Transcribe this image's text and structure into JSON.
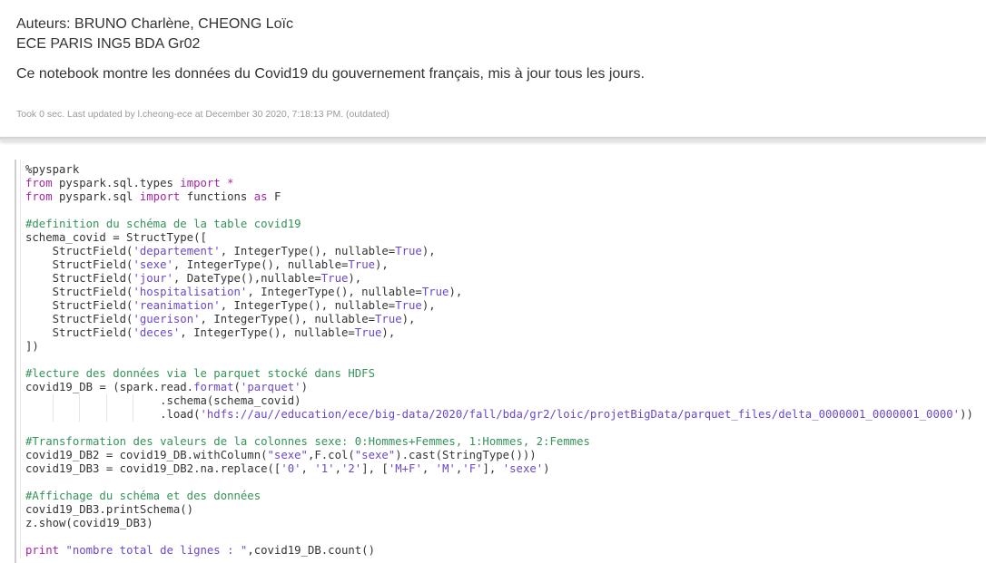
{
  "markdown": {
    "lines": [
      "Auteurs: BRUNO Charlène, CHEONG Loïc",
      "ECE PARIS ING5 BDA Gr02",
      "Ce notebook montre les données du Covid19 du gouvernement français, mis à jour tous les jours."
    ]
  },
  "status": {
    "text": "Took 0 sec. Last updated by l.cheong-ece at December 30 2020, 7:18:13 PM. (outdated)"
  },
  "code": {
    "lines": [
      [
        {
          "t": "magic",
          "v": "%pyspark"
        }
      ],
      [
        {
          "t": "kw",
          "v": "from"
        },
        {
          "t": "plain",
          "v": " pyspark.sql.types "
        },
        {
          "t": "kw",
          "v": "import"
        },
        {
          "t": "plain",
          "v": " "
        },
        {
          "t": "kw",
          "v": "*"
        }
      ],
      [
        {
          "t": "kw",
          "v": "from"
        },
        {
          "t": "plain",
          "v": " pyspark.sql "
        },
        {
          "t": "kw",
          "v": "import"
        },
        {
          "t": "plain",
          "v": " functions "
        },
        {
          "t": "kw",
          "v": "as"
        },
        {
          "t": "plain",
          "v": " F"
        }
      ],
      [],
      [
        {
          "t": "com",
          "v": "#definition du schéma de la table covid19"
        }
      ],
      [
        {
          "t": "plain",
          "v": "schema_covid = StructType(["
        }
      ],
      [
        {
          "t": "plain",
          "v": "    StructField("
        },
        {
          "t": "str",
          "v": "'departement'"
        },
        {
          "t": "plain",
          "v": ", IntegerType(), nullable="
        },
        {
          "t": "str",
          "v": "True"
        },
        {
          "t": "plain",
          "v": "),"
        }
      ],
      [
        {
          "t": "plain",
          "v": "    StructField("
        },
        {
          "t": "str",
          "v": "'sexe'"
        },
        {
          "t": "plain",
          "v": ", IntegerType(), nullable="
        },
        {
          "t": "str",
          "v": "True"
        },
        {
          "t": "plain",
          "v": "),"
        }
      ],
      [
        {
          "t": "plain",
          "v": "    StructField("
        },
        {
          "t": "str",
          "v": "'jour'"
        },
        {
          "t": "plain",
          "v": ", DateType(),nullable="
        },
        {
          "t": "str",
          "v": "True"
        },
        {
          "t": "plain",
          "v": "),"
        }
      ],
      [
        {
          "t": "plain",
          "v": "    StructField("
        },
        {
          "t": "str",
          "v": "'hospitalisation'"
        },
        {
          "t": "plain",
          "v": ", IntegerType(), nullable="
        },
        {
          "t": "str",
          "v": "True"
        },
        {
          "t": "plain",
          "v": "),"
        }
      ],
      [
        {
          "t": "plain",
          "v": "    StructField("
        },
        {
          "t": "str",
          "v": "'reanimation'"
        },
        {
          "t": "plain",
          "v": ", IntegerType(), nullable="
        },
        {
          "t": "str",
          "v": "True"
        },
        {
          "t": "plain",
          "v": "),"
        }
      ],
      [
        {
          "t": "plain",
          "v": "    StructField("
        },
        {
          "t": "str",
          "v": "'guerison'"
        },
        {
          "t": "plain",
          "v": ", IntegerType(), nullable="
        },
        {
          "t": "str",
          "v": "True"
        },
        {
          "t": "plain",
          "v": "),"
        }
      ],
      [
        {
          "t": "plain",
          "v": "    StructField("
        },
        {
          "t": "str",
          "v": "'deces'"
        },
        {
          "t": "plain",
          "v": ", IntegerType(), nullable="
        },
        {
          "t": "str",
          "v": "True"
        },
        {
          "t": "plain",
          "v": "),"
        }
      ],
      [
        {
          "t": "plain",
          "v": "])"
        }
      ],
      [],
      [
        {
          "t": "com",
          "v": "#lecture des données via le parquet stocké dans HDFS"
        }
      ],
      [
        {
          "t": "plain",
          "v": "covid19_DB = (spark.read."
        },
        {
          "t": "str",
          "v": "format"
        },
        {
          "t": "plain",
          "v": "("
        },
        {
          "t": "str",
          "v": "'parquet'"
        },
        {
          "t": "plain",
          "v": ")"
        }
      ],
      [
        {
          "t": "plain",
          "v": "                    .schema(schema_covid)"
        }
      ],
      [
        {
          "t": "plain",
          "v": "                    .load("
        },
        {
          "t": "str",
          "v": "'hdfs://au//education/ece/big-data/2020/fall/bda/gr2/loic/projetBigData/parquet_files/delta_0000001_0000001_0000'"
        },
        {
          "t": "plain",
          "v": "))"
        }
      ],
      [],
      [
        {
          "t": "com",
          "v": "#Transformation des valeurs de la colonnes sexe: 0:Hommes+Femmes, 1:Hommes, 2:Femmes"
        }
      ],
      [
        {
          "t": "plain",
          "v": "covid19_DB2 = covid19_DB.withColumn("
        },
        {
          "t": "str",
          "v": "\"sexe\""
        },
        {
          "t": "plain",
          "v": ",F.col("
        },
        {
          "t": "str",
          "v": "\"sexe\""
        },
        {
          "t": "plain",
          "v": ").cast(StringType()))"
        }
      ],
      [
        {
          "t": "plain",
          "v": "covid19_DB3 = covid19_DB2.na.replace(["
        },
        {
          "t": "str",
          "v": "'0'"
        },
        {
          "t": "plain",
          "v": ", "
        },
        {
          "t": "str",
          "v": "'1'"
        },
        {
          "t": "plain",
          "v": ","
        },
        {
          "t": "str",
          "v": "'2'"
        },
        {
          "t": "plain",
          "v": "], ["
        },
        {
          "t": "str",
          "v": "'M+F'"
        },
        {
          "t": "plain",
          "v": ", "
        },
        {
          "t": "str",
          "v": "'M'"
        },
        {
          "t": "plain",
          "v": ","
        },
        {
          "t": "str",
          "v": "'F'"
        },
        {
          "t": "plain",
          "v": "], "
        },
        {
          "t": "str",
          "v": "'sexe'"
        },
        {
          "t": "plain",
          "v": ")"
        }
      ],
      [],
      [
        {
          "t": "com",
          "v": "#Affichage du schéma et des données"
        }
      ],
      [
        {
          "t": "plain",
          "v": "covid19_DB3.printSchema()"
        }
      ],
      [
        {
          "t": "plain",
          "v": "z.show(covid19_DB3)"
        }
      ],
      [],
      [
        {
          "t": "kw",
          "v": "print"
        },
        {
          "t": "plain",
          "v": " "
        },
        {
          "t": "str",
          "v": "\"nombre total de lignes : \""
        },
        {
          "t": "plain",
          "v": ",covid19_DB.count()"
        }
      ]
    ]
  },
  "colors": {
    "keyword": "#a626a4",
    "string": "#6a48c8",
    "comment": "#35925a",
    "text": "#333333"
  }
}
